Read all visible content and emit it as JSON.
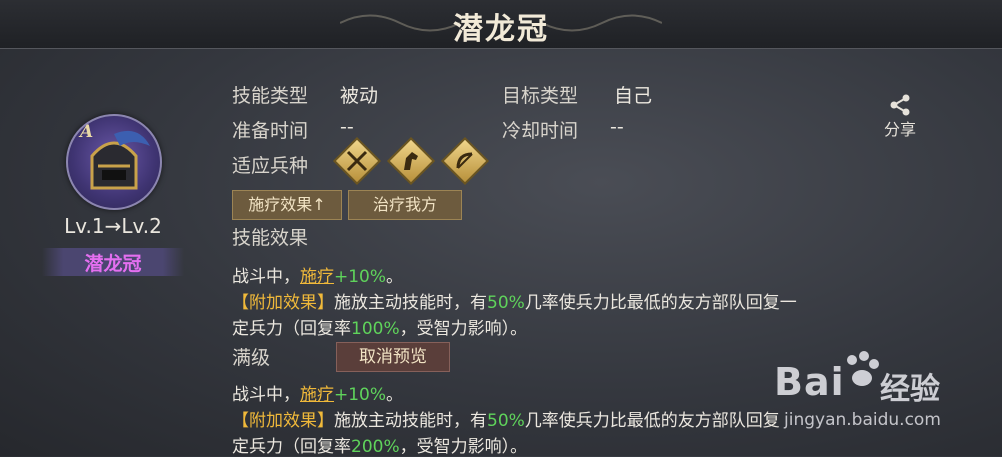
{
  "header": {
    "title": "潜龙冠"
  },
  "hero": {
    "badge": "A",
    "level": "Lv.1→Lv.2",
    "name": "潜龙冠"
  },
  "info": {
    "skill_type_label": "技能类型",
    "skill_type_value": "被动",
    "target_type_label": "目标类型",
    "target_type_value": "自己",
    "prep_time_label": "准备时间",
    "prep_time_value": "--",
    "cooldown_label": "冷却时间",
    "cooldown_value": "--",
    "troop_label": "适应兵种",
    "troop_icons": [
      "shield-sword-icon",
      "horse-icon",
      "bow-icon"
    ]
  },
  "share": {
    "label": "分享",
    "icon": "share-icon"
  },
  "tags": [
    "施疗效果↑",
    "治疗我方"
  ],
  "effect": {
    "title": "技能效果",
    "line1_prefix": "战斗中，",
    "line1_heal": "施疗",
    "line1_value": "+10%",
    "line1_suffix": "。",
    "extra_label": "【附加效果】",
    "extra_text_a": "施放主动技能时，有",
    "extra_chance": "50%",
    "extra_text_b": "几率使兵力比最低的友方部队回复一",
    "extra_text_c": "定兵力（回复率",
    "extra_rate": "100%",
    "extra_text_d": "，受智力影响）。"
  },
  "max_level": {
    "label": "满级",
    "cancel_button": "取消预览",
    "line1_prefix": "战斗中，",
    "line1_heal": "施疗",
    "line1_value": "+10%",
    "line1_suffix": "。",
    "extra_label": "【附加效果】",
    "extra_text_a": "施放主动技能时，有",
    "extra_chance": "50%",
    "extra_text_b": "几率使兵力比最低的友方部队回复",
    "extra_text_c": "定兵力（回复率",
    "extra_rate": "200%",
    "extra_text_d": "，受智力影响）。"
  },
  "watermark": {
    "logo_a": "Bai",
    "logo_b": "经验",
    "url": "jingyan.baidu.com"
  }
}
